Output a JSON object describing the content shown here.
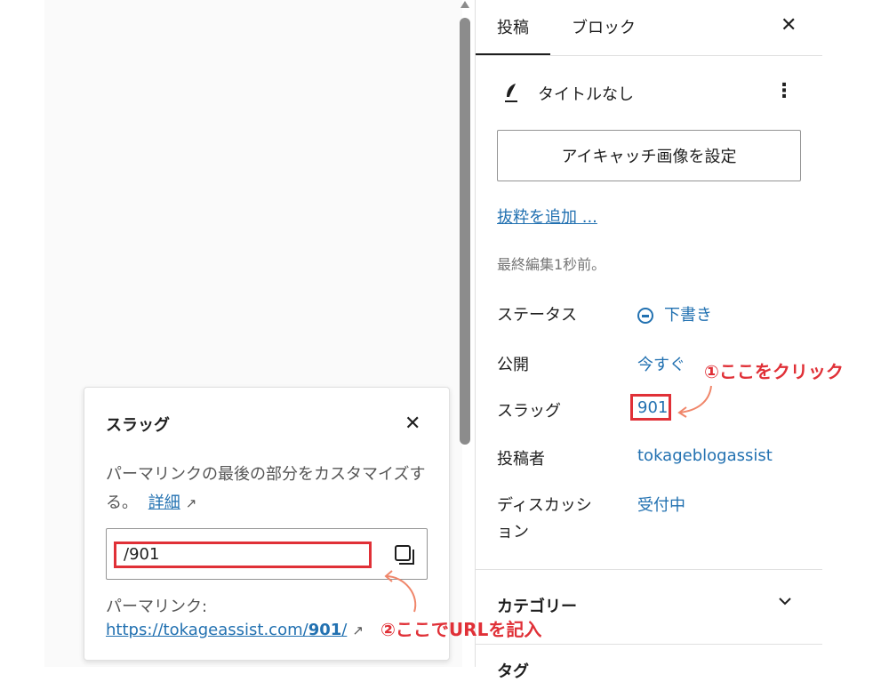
{
  "sidebar": {
    "tabs": [
      {
        "label": "投稿"
      },
      {
        "label": "ブロック"
      }
    ],
    "close_glyph": "✕",
    "post_title": "タイトルなし",
    "more_glyph": "⋮",
    "featured_image_button": "アイキャッチ画像を設定",
    "excerpt_link": "抜粋を追加 ...",
    "last_edited": "最終編集1秒前。",
    "rows": [
      {
        "label": "ステータス",
        "value": "下書き"
      },
      {
        "label": "公開",
        "value": "今すぐ"
      },
      {
        "label": "スラッグ",
        "value": "901"
      },
      {
        "label": "投稿者",
        "value": "tokageblogassist"
      },
      {
        "label_line1": "ディスカッシ",
        "label_line2": "ョン",
        "value": "受付中"
      }
    ],
    "category_section": "カテゴリー",
    "next_section_partial": "タグ"
  },
  "popover": {
    "title": "スラッグ",
    "close_glyph": "✕",
    "help_text": "パーマリンクの最後の部分をカスタマイズする。",
    "help_link": "詳細",
    "ext_glyph": "↗",
    "slug_value": "/901",
    "permalink_label": "パーマリンク:",
    "permalink_prefix": "https://tokageassist.com/",
    "permalink_slug": "901",
    "permalink_suffix": "/"
  },
  "annotations": {
    "step1": "①ここをクリック",
    "step2": "②ここでURLを記入"
  },
  "colors": {
    "accent": "#2271b1",
    "annotation_red": "#e03037",
    "arrow_orange": "#f0866a"
  },
  "icons": [
    "feather-icon",
    "status-draft-icon",
    "copy-icon",
    "chevron-down-icon",
    "close-icon",
    "external-link-icon"
  ]
}
